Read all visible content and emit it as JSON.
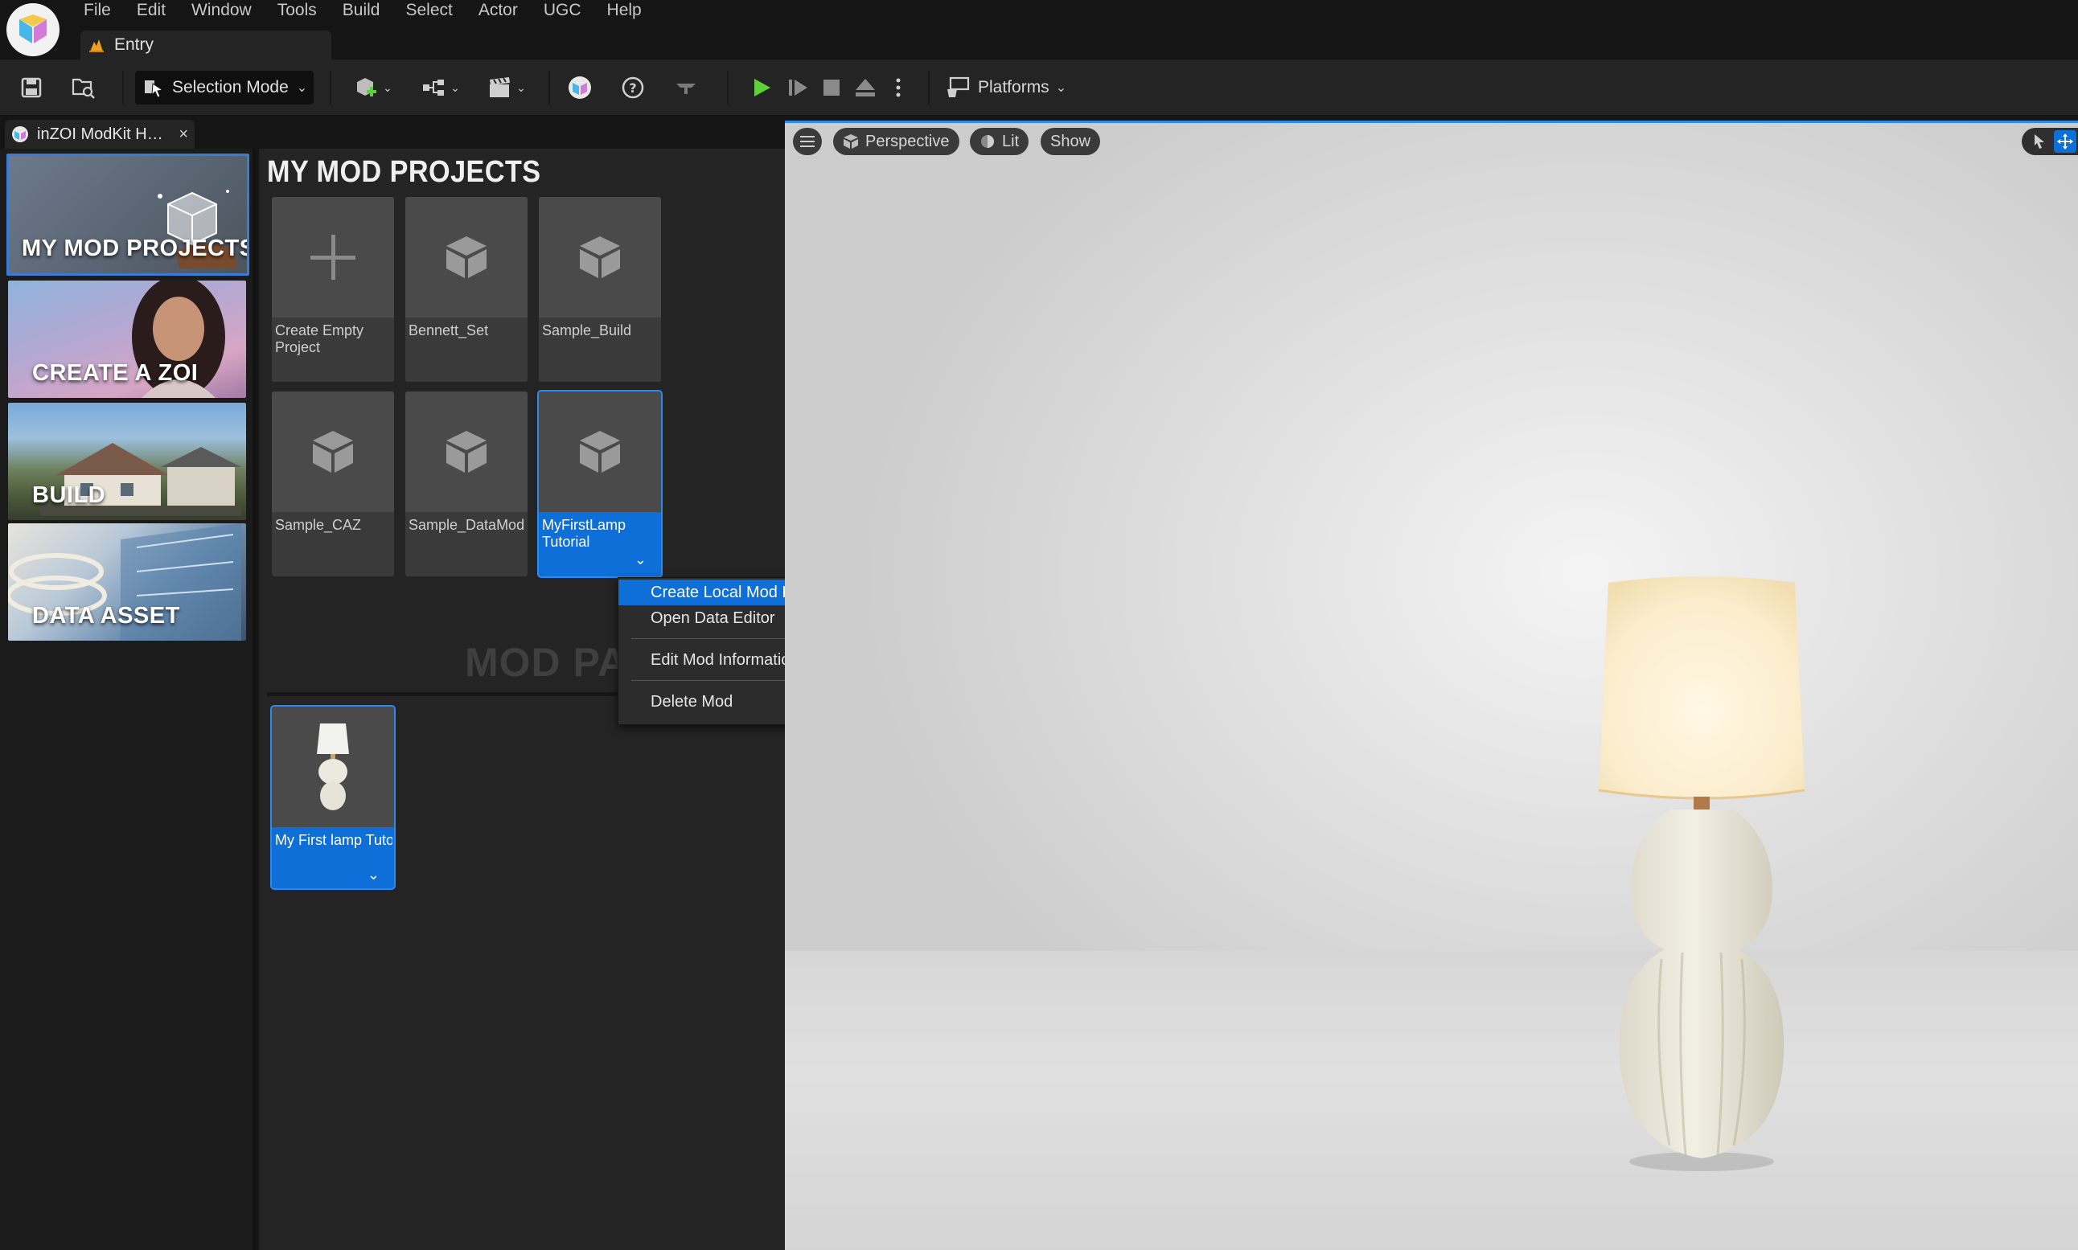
{
  "menu": {
    "items": [
      "File",
      "Edit",
      "Window",
      "Tools",
      "Build",
      "Select",
      "Actor",
      "UGC",
      "Help"
    ]
  },
  "level_tab": {
    "label": "Entry",
    "icon": "level-icon"
  },
  "toolbar": {
    "selection_mode_label": "Selection Mode",
    "platforms_label": "Platforms",
    "icons": [
      "save-icon",
      "content-browser-icon",
      "add-actor-icon",
      "blueprint-icon",
      "cinematics-icon",
      "inzoi-icon",
      "help-icon",
      "settings-icon",
      "play-icon",
      "step-icon",
      "stop-icon",
      "eject-icon",
      "more-icon"
    ]
  },
  "doc_tab": {
    "label": "inZOI ModKit H…",
    "close": "×"
  },
  "categories": [
    {
      "label": "MY MOD PROJECTS",
      "selected": true
    },
    {
      "label": "CREATE A ZOI",
      "selected": false
    },
    {
      "label": "BUILD",
      "selected": false
    },
    {
      "label": "DATA ASSET",
      "selected": false
    }
  ],
  "projects": {
    "title": "MY MOD PROJECTS",
    "cards": [
      {
        "name": "Create Empty Project",
        "icon": "plus-icon"
      },
      {
        "name": "Bennett_Set",
        "icon": "cube-icon"
      },
      {
        "name": "Sample_Build",
        "icon": "cube-icon"
      },
      {
        "name": "Sample_CAZ",
        "icon": "cube-icon"
      },
      {
        "name": "Sample_DataMod",
        "icon": "cube-icon"
      },
      {
        "name": "MyFirstLamp Tutorial",
        "icon": "cube-icon",
        "selected": true
      }
    ]
  },
  "packages": {
    "title": "MOD PACKAGES",
    "cards": [
      {
        "name": "My First lamp Tutorial",
        "icon": "lamp-thumbnail",
        "selected": true
      }
    ]
  },
  "context_menu": {
    "items": [
      "Create Local Mod Package",
      "Open Data Editor",
      "Edit Mod Information",
      "Delete Mod"
    ],
    "active_index": 0
  },
  "viewport": {
    "perspective_label": "Perspective",
    "lit_label": "Lit",
    "show_label": "Show"
  },
  "colors": {
    "accent": "#0e6fd8",
    "play_green": "#5fcf3a",
    "panel": "#242424",
    "background": "#151515"
  }
}
